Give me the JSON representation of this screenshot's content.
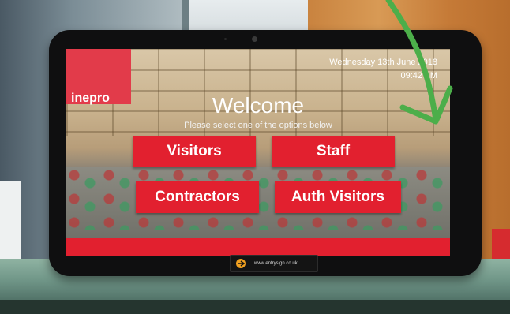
{
  "brand": {
    "name": "inepro"
  },
  "kiosk": {
    "date": "Wednesday 13th June 2018",
    "time": "09:42 AM",
    "heading": "Welcome",
    "subheading": "Please select one of the options below",
    "buttons": {
      "visitors": "Visitors",
      "staff": "Staff",
      "contractors": "Contractors",
      "auth_visitors": "Auth Visitors"
    }
  },
  "stand": {
    "badge_text": "www.entrysign.co.uk"
  },
  "colors": {
    "accent": "#e2202f",
    "arrow": "#4cae4a"
  }
}
